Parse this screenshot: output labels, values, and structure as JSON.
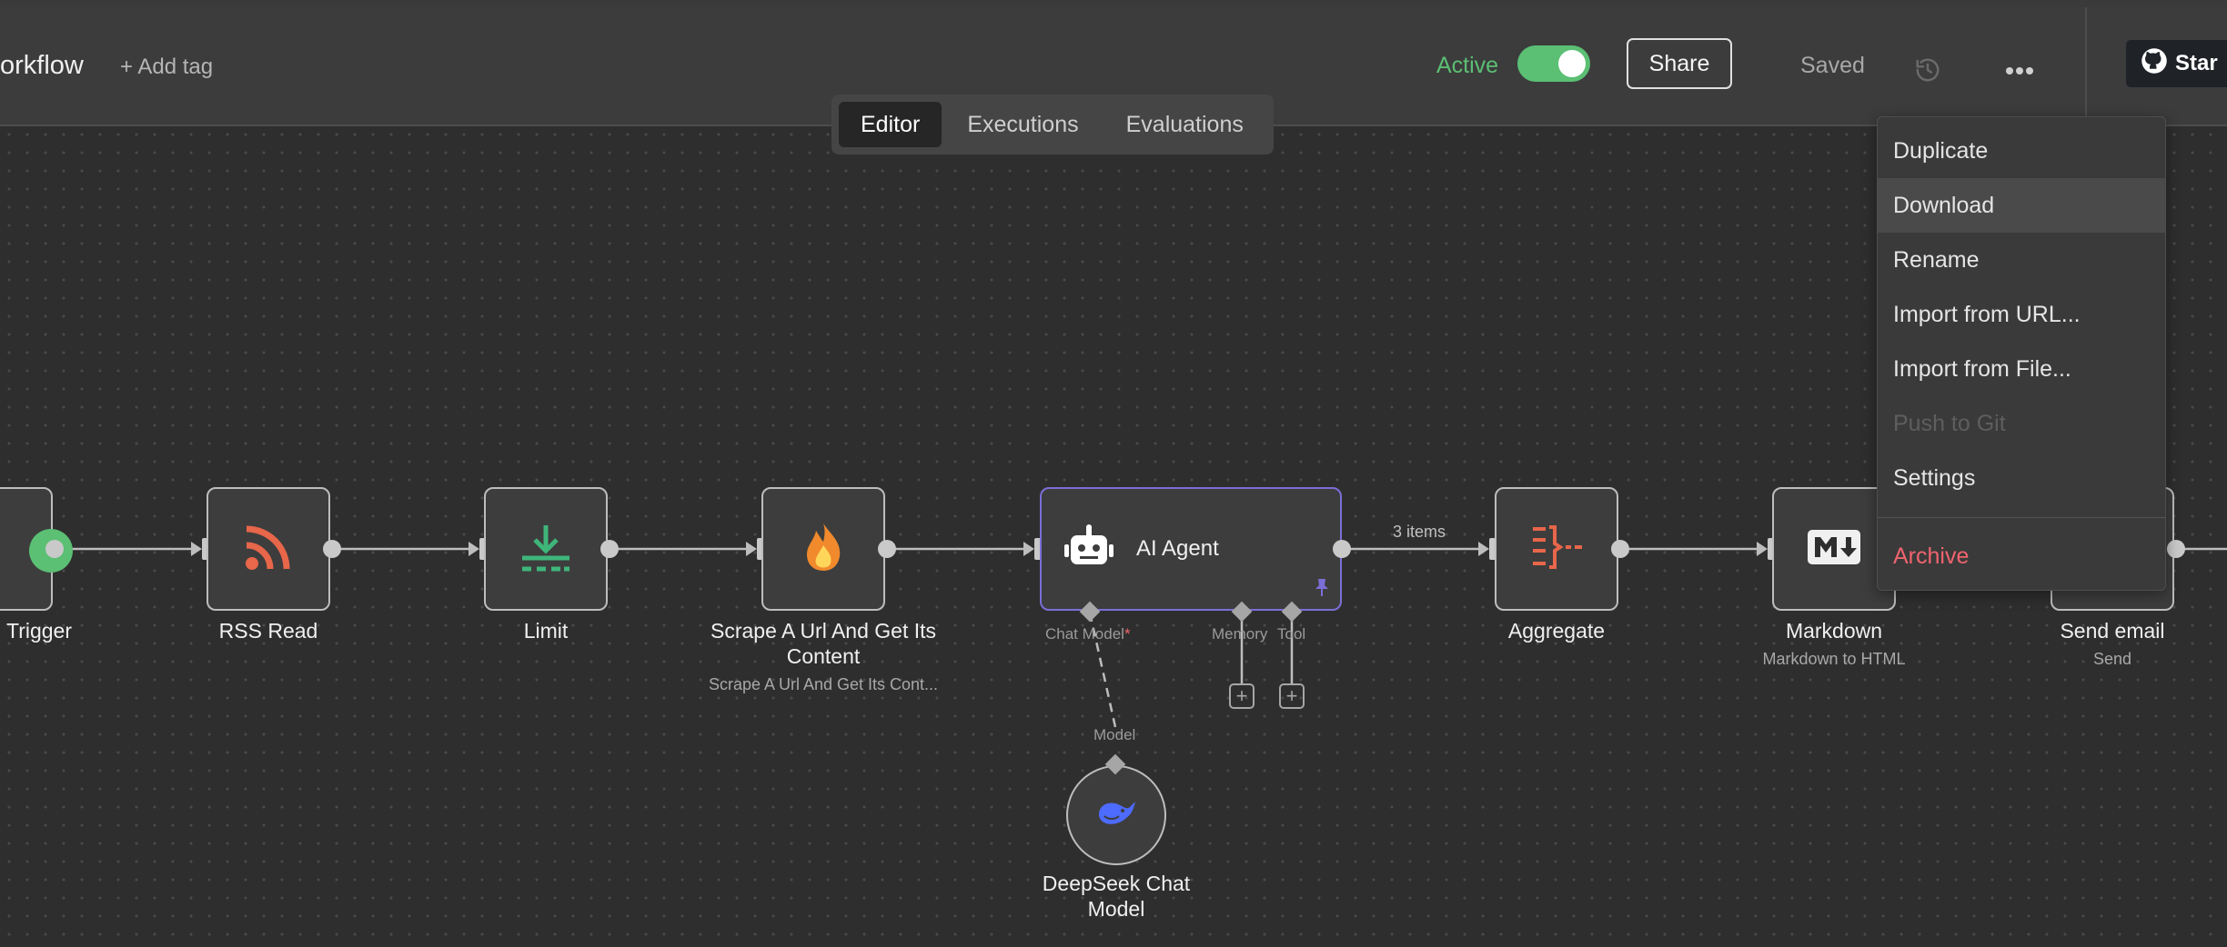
{
  "header": {
    "workflow_name": "orkflow",
    "add_tag": "+ Add tag",
    "active_label": "Active",
    "active_on": true,
    "share_label": "Share",
    "saved_label": "Saved",
    "github_label": "Star"
  },
  "tabs": [
    {
      "label": "Editor",
      "active": true
    },
    {
      "label": "Executions",
      "active": false
    },
    {
      "label": "Evaluations",
      "active": false
    }
  ],
  "nodes": {
    "trigger": {
      "label": "Trigger",
      "icon": "trigger-icon"
    },
    "rss": {
      "label": "RSS Read",
      "icon": "rss-icon"
    },
    "limit": {
      "label": "Limit",
      "icon": "download-arrow-icon"
    },
    "scrape": {
      "label_line1": "Scrape A Url And Get Its",
      "label_line2": "Content",
      "subtitle": "Scrape A Url And Get Its Cont...",
      "icon": "fire-icon"
    },
    "agent": {
      "label": "AI Agent",
      "icon": "robot-icon",
      "chat_model": "Chat Model",
      "required": "*",
      "memory": "Memory",
      "tool": "Tool"
    },
    "edge_items": "3 items",
    "aggregate": {
      "label": "Aggregate",
      "icon": "aggregate-icon"
    },
    "markdown": {
      "label": "Markdown",
      "subtitle": "Markdown to HTML",
      "icon": "markdown-icon"
    },
    "email": {
      "label": "Send email",
      "subtitle": "Send",
      "icon": "email-icon"
    },
    "deepseek": {
      "label_line1": "DeepSeek Chat",
      "label_line2": "Model",
      "model_label": "Model",
      "icon": "deepseek-whale-icon"
    }
  },
  "menu": {
    "items": [
      {
        "label": "Duplicate",
        "state": "normal"
      },
      {
        "label": "Download",
        "state": "hover"
      },
      {
        "label": "Rename",
        "state": "normal"
      },
      {
        "label": "Import from URL...",
        "state": "normal"
      },
      {
        "label": "Import from File...",
        "state": "normal"
      },
      {
        "label": "Push to Git",
        "state": "disabled"
      },
      {
        "label": "Settings",
        "state": "normal"
      },
      {
        "label": "Archive",
        "state": "danger"
      }
    ]
  },
  "colors": {
    "accent_green": "#5bbf74",
    "node_accent_orange": "#e8664a",
    "agent_border": "#7b6fd6",
    "danger": "#f0646e"
  }
}
